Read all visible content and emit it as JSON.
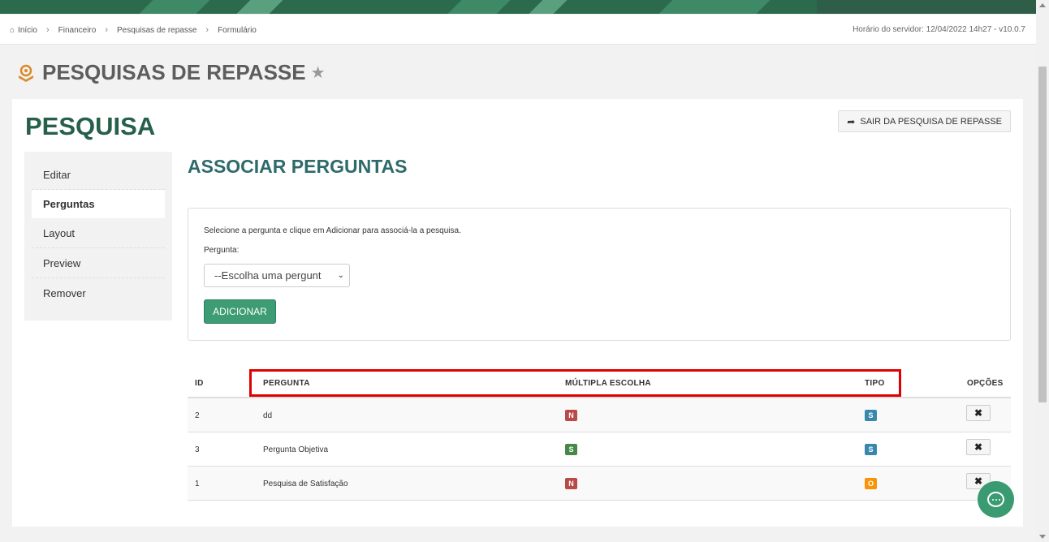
{
  "breadcrumb": {
    "items": [
      "Início",
      "Financeiro",
      "Pesquisas de repasse",
      "Formulário"
    ]
  },
  "server_time": "Horário do servidor: 12/04/2022 14h27 - v10.0.7",
  "page": {
    "title": "PESQUISAS DE REPASSE"
  },
  "card": {
    "title": "PESQUISA",
    "exit_label": "SAIR DA PESQUISA DE REPASSE"
  },
  "sidemenu": {
    "items": [
      {
        "label": "Editar",
        "active": false
      },
      {
        "label": "Perguntas",
        "active": true
      },
      {
        "label": "Layout",
        "active": false
      },
      {
        "label": "Preview",
        "active": false
      },
      {
        "label": "Remover",
        "active": false
      }
    ]
  },
  "section": {
    "title": "ASSOCIAR PERGUNTAS",
    "help": "Selecione a pergunta e clique em Adicionar para associá-la a pesquisa.",
    "field_label": "Pergunta:",
    "select_value": "--Escolha uma pergunt",
    "add_label": "ADICIONAR"
  },
  "table": {
    "headers": [
      "ID",
      "PERGUNTA",
      "MÚLTIPLA ESCOLHA",
      "TIPO",
      "OPÇÕES"
    ],
    "rows": [
      {
        "id": "2",
        "pergunta": "dd",
        "multipla": "N",
        "tipo": "S"
      },
      {
        "id": "3",
        "pergunta": "Pergunta Objetiva",
        "multipla": "S",
        "tipo": "S"
      },
      {
        "id": "1",
        "pergunta": "Pesquisa de Satisfação",
        "multipla": "N",
        "tipo": "O"
      }
    ],
    "option_icon": "✖"
  },
  "colors": {
    "brand_green": "#27604a",
    "button_green": "#3d9c73",
    "badge_N": "#b94a48",
    "badge_S_multipla": "#468847",
    "badge_S_tipo": "#3a87ad",
    "badge_O": "#f89406",
    "highlight": "#e00000"
  },
  "icons": {
    "home": "home-icon",
    "star": "star-icon",
    "share": "share-icon",
    "chat": "chat-icon",
    "remove": "remove-icon"
  }
}
